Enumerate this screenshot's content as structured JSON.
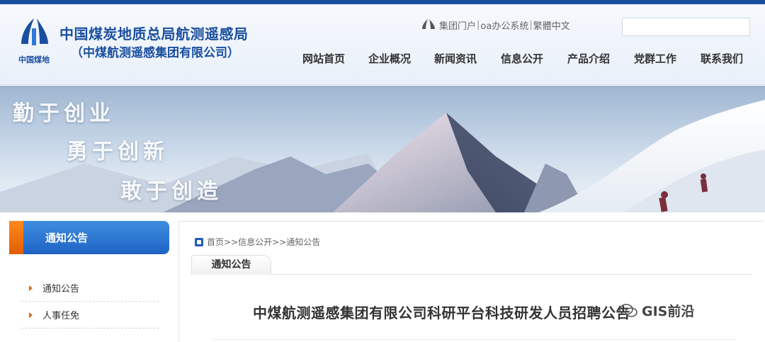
{
  "header": {
    "org_title": "中国煤炭地质总局航测遥感局",
    "org_subtitle": "（中煤航测遥感集团有限公司）",
    "logo_text": "中国煤地",
    "top_links": [
      "集团门户",
      "oa办公系统",
      "繁體中文"
    ],
    "search_placeholder": ""
  },
  "nav": {
    "items": [
      "网站首页",
      "企业概况",
      "新闻资讯",
      "信息公开",
      "产品介绍",
      "党群工作",
      "联系我们"
    ]
  },
  "banner": {
    "slogans": [
      "勤于创业",
      "勇于创新",
      "敢于创造"
    ]
  },
  "sidebar": {
    "title": "通知公告",
    "items": [
      "通知公告",
      "人事任免"
    ]
  },
  "main": {
    "breadcrumb": "首页>>信息公开>>通知公告",
    "tab": "通知公告",
    "article_title": "中煤航测遥感集团有限公司科研平台科技研发人员招聘公告"
  },
  "watermark": {
    "text": "GIS前沿"
  },
  "colors": {
    "brand_blue": "#1a4fa0",
    "sidebar_blue": "#1e63c4",
    "accent_orange": "#e05d00"
  }
}
